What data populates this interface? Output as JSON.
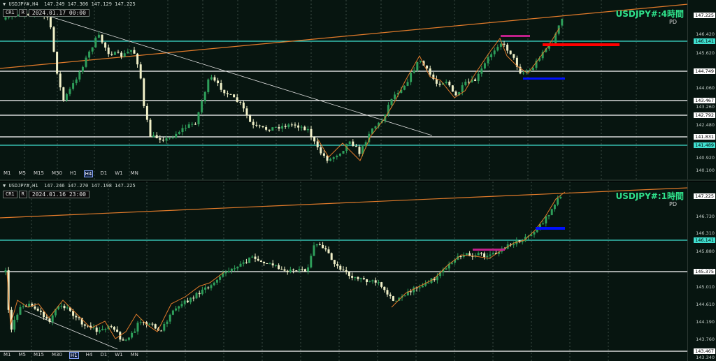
{
  "top": {
    "header": "USDJPY#,H4  147.249 147.306 147.129 147.225",
    "buttons": [
      "CR1",
      "R"
    ],
    "datetime": "2024.01.17 00:00",
    "title": "USDJPY#:4時間",
    "pd": "PD",
    "ticks": [
      "147.225",
      "146.420",
      "145.620",
      "144.060",
      "143.260",
      "142.480",
      "141.660",
      "140.920",
      "140.100"
    ],
    "levels": [
      "146.141",
      "144.749",
      "143.467",
      "142.792",
      "141.831",
      "141.489"
    ],
    "timeframes": [
      "M1",
      "M5",
      "M15",
      "M30",
      "H1",
      "H4",
      "D1",
      "W1",
      "MN"
    ],
    "active_tf": "H4"
  },
  "bottom": {
    "header": "USDJPY#,H1  147.246 147.270 147.198 147.225",
    "buttons": [
      "CR1",
      "R"
    ],
    "datetime": "2024.01.16 23:00",
    "title": "USDJPY#:1時間",
    "pd": "PD",
    "ticks": [
      "147.225",
      "146.730",
      "146.310",
      "145.880",
      "145.010",
      "144.610",
      "144.190",
      "143.760",
      "143.340"
    ],
    "levels": [
      "146.141",
      "145.375",
      "143.467"
    ],
    "timeframes": [
      "M1",
      "M5",
      "M15",
      "M30",
      "H1",
      "H4",
      "D1",
      "W1",
      "MN"
    ],
    "active_tf": "H1"
  },
  "colors": {
    "bull": "#2e9e5a",
    "bear": "#f0f0c8",
    "cyan": "#40e0d0",
    "trend": "#e07a2a",
    "label": "#2fe08a",
    "magenta": "#c0208a",
    "red": "#ff0000",
    "blue": "#0010ff"
  }
}
